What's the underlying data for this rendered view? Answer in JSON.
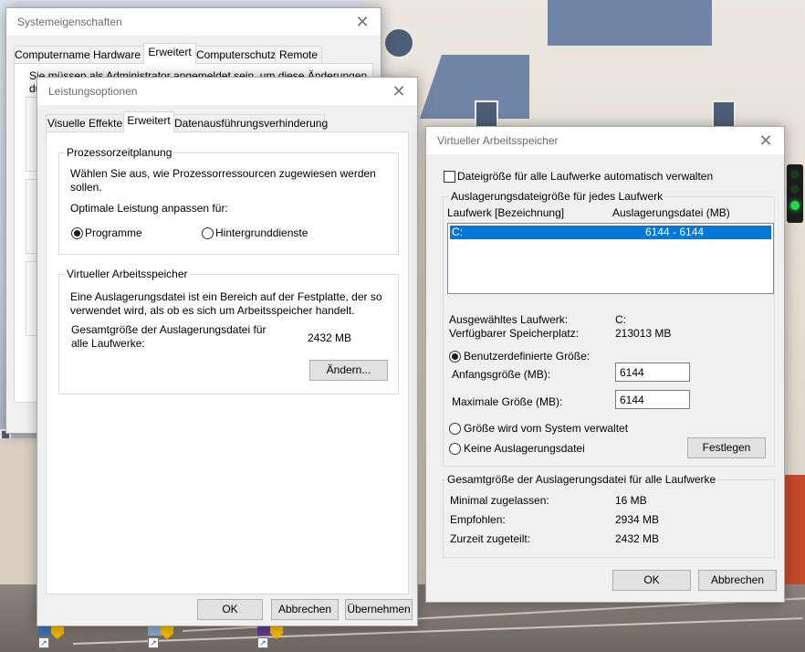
{
  "systemeigenschaften": {
    "title": "Systemeigenschaften",
    "tabs": [
      "Computername",
      "Hardware",
      "Erweitert",
      "Computerschutz",
      "Remote"
    ],
    "notice": "Sie müssen als Administrator angemeldet sein, um diese Änderungen",
    "notice_cont": "du"
  },
  "leistungsoptionen": {
    "title": "Leistungsoptionen",
    "tabs": [
      "Visuelle Effekte",
      "Erweitert",
      "Datenausführungsverhinderung"
    ],
    "cpu_group": {
      "title": "Prozessorzeitplanung",
      "description": "Wählen Sie aus, wie Prozessorressourcen zugewiesen werden sollen.",
      "adjust_label": "Optimale Leistung anpassen für:",
      "option_programs": "Programme",
      "option_services": "Hintergrunddienste",
      "selected": "Programme"
    },
    "vm_group": {
      "title": "Virtueller Arbeitsspeicher",
      "description": "Eine Auslagerungsdatei ist ein Bereich auf der Festplatte, der so verwendet wird, als ob es sich um Arbeitsspeicher handelt.",
      "total_label": "Gesamtgröße der Auslagerungsdatei für alle Laufwerke:",
      "total_value": "2432 MB",
      "change_button": "Ändern..."
    },
    "buttons": {
      "ok": "OK",
      "cancel": "Abbrechen",
      "apply": "Übernehmen"
    }
  },
  "virtueller_arbeitsspeicher": {
    "title": "Virtueller Arbeitsspeicher",
    "auto_manage_label": "Dateigröße für alle Laufwerke automatisch verwalten",
    "auto_manage_checked": false,
    "per_drive_group_title": "Auslagerungsdateigröße für jedes Laufwerk",
    "columns": [
      "Laufwerk [Bezeichnung]",
      "Auslagerungsdatei (MB)"
    ],
    "drives": [
      {
        "drive": "C:",
        "size": "6144 - 6144",
        "selected": true
      }
    ],
    "selected_drive_label": "Ausgewähltes Laufwerk:",
    "selected_drive_value": "C:",
    "free_space_label": "Verfügbarer Speicherplatz:",
    "free_space_value": "213013 MB",
    "custom_size_label": "Benutzerdefinierte Größe:",
    "initial_size_label": "Anfangsgröße (MB):",
    "initial_size_value": "6144",
    "max_size_label": "Maximale Größe (MB):",
    "max_size_value": "6144",
    "system_managed_label": "Größe wird vom System verwaltet",
    "no_paging_label": "Keine Auslagerungsdatei",
    "selected_option": "Benutzerdefinierte Größe",
    "set_button": "Festlegen",
    "totals_group_title": "Gesamtgröße der Auslagerungsdatei für alle Laufwerke",
    "min_label": "Minimal zugelassen:",
    "min_value": "16 MB",
    "recommended_label": "Empfohlen:",
    "recommended_value": "2934 MB",
    "current_label": "Zurzeit zugeteilt:",
    "current_value": "2432 MB",
    "buttons": {
      "ok": "OK",
      "cancel": "Abbrechen"
    }
  },
  "colors": {
    "selection": "#0078d7",
    "dialog_bg": "#f0f0f0",
    "titlebar": "#ffffff"
  },
  "icons": [
    "close-icon",
    "shield-icon",
    "shortcut-arrow-icon",
    "traffic-light"
  ]
}
